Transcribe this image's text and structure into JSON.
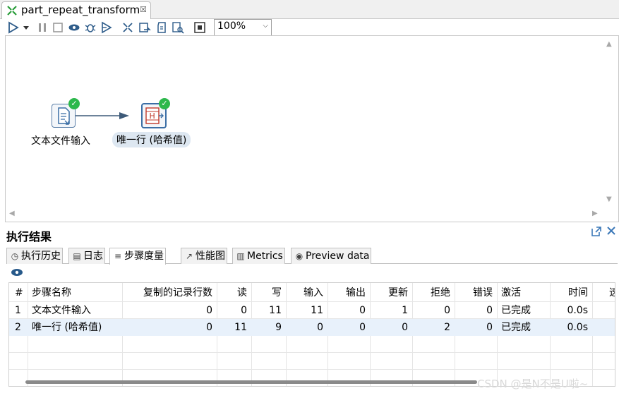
{
  "editor_tab": {
    "title": "part_repeat_transform",
    "close": "☒"
  },
  "toolbar": {
    "zoom": "100%"
  },
  "canvas": {
    "step1": {
      "label": "文本文件输入"
    },
    "step2": {
      "label": "唯一行 (哈希值)"
    }
  },
  "results": {
    "title": "执行结果",
    "tabs": [
      {
        "label": "执行历史"
      },
      {
        "label": "日志"
      },
      {
        "label": "步骤度量"
      },
      {
        "label": "性能图"
      },
      {
        "label": "Metrics"
      },
      {
        "label": "Preview data"
      }
    ],
    "columns": [
      "#",
      "步骤名称",
      "复制的记录行数",
      "读",
      "写",
      "输入",
      "输出",
      "更新",
      "拒绝",
      "错误",
      "激活",
      "时间",
      "速"
    ],
    "rows": [
      [
        "1",
        "文本文件输入",
        "0",
        "0",
        "11",
        "11",
        "0",
        "1",
        "0",
        "0",
        "已完成",
        "0.0s"
      ],
      [
        "2",
        "唯一行 (哈希值)",
        "0",
        "11",
        "9",
        "0",
        "0",
        "0",
        "2",
        "0",
        "已完成",
        "0.0s"
      ]
    ]
  },
  "watermark": "CSDN @是N不是U啦~",
  "colors": {
    "accent": "#3b6ea5",
    "ok": "#2db84c",
    "selection": "#e8f1fb"
  }
}
